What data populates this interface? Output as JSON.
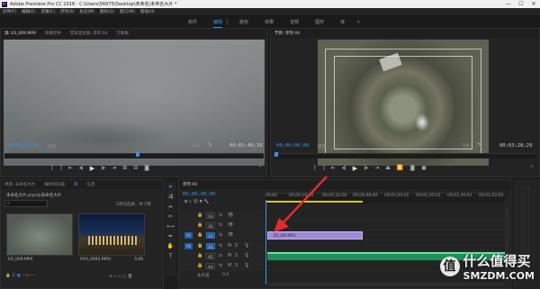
{
  "window": {
    "title": "Adobe Premiere Pro CC 2018 - C:\\Users\\56975\\Desktop\\未命名\\未命名大片 *",
    "app_icon": "Pr",
    "controls": [
      "—",
      "☐",
      "✕"
    ]
  },
  "menu": [
    "文件(F)",
    "编辑(E)",
    "剪辑(C)",
    "序列(S)",
    "标记(M)",
    "图形(G)",
    "窗口(W)",
    "帮助(H)"
  ],
  "workspaces": {
    "items": [
      "组件",
      "编辑",
      "颜色",
      "效果",
      "音频",
      "图形",
      "库"
    ],
    "active_index": 1,
    "more": "»"
  },
  "source_monitor": {
    "tabs": [
      "源: 03_009.MP4",
      "效果控件",
      "音轨混合器: 序列 04",
      "元数据"
    ],
    "timecode_in": "00;00;55;00",
    "fit": "适合",
    "resolution": "1/4",
    "timecode_dur": "00;01;48;18"
  },
  "program_monitor": {
    "tabs": [
      "节目: 序列 04"
    ],
    "timecode_in": "00;00;00;00",
    "fit": "适合",
    "resolution": "1/4",
    "timecode_dur": "00;03;28;29"
  },
  "project_panel": {
    "tabs": [
      "项目: 未命名大片",
      "媒体浏览器",
      "库",
      "信息"
    ],
    "project_file": "未命名大片.prproj\\未命名大片",
    "selection_note": "1项已选择，共 2项",
    "items": [
      {
        "name": "03_009.MP4",
        "duration": ""
      },
      {
        "name": "IVVI_0092.MOV",
        "duration": "3;06"
      }
    ]
  },
  "timeline": {
    "tabs": [
      "序列 04"
    ],
    "timecode": "00;00;00;00",
    "ruler_labels": [
      "00;00",
      "00;00;16;00",
      "00;00;32;00",
      "00;00;48;00",
      "00;01;04;02",
      "00;01;20;02",
      "00;01;36;02",
      "00;01;52;02"
    ],
    "tracks": [
      {
        "id": "V3",
        "kind": "video"
      },
      {
        "id": "V2",
        "kind": "video"
      },
      {
        "id": "V1",
        "kind": "video",
        "source": "V1"
      },
      {
        "id": "A1",
        "kind": "audio",
        "source": "A1"
      },
      {
        "id": "A2",
        "kind": "audio"
      },
      {
        "id": "A3",
        "kind": "audio"
      }
    ],
    "master": {
      "label": "主声道",
      "value": "0.0"
    },
    "clips": [
      {
        "track": "V1",
        "label": "03_009.MP4"
      },
      {
        "track": "A1",
        "label": ""
      }
    ]
  },
  "watermark": {
    "logo": "值",
    "text": "什么值得买",
    "sub": "SMZDM.COM"
  },
  "icons": {
    "tools": [
      "selection-tool-icon",
      "track-select-icon",
      "ripple-edit-icon",
      "razor-icon",
      "slip-icon",
      "pen-icon",
      "hand-icon",
      "type-icon"
    ]
  }
}
